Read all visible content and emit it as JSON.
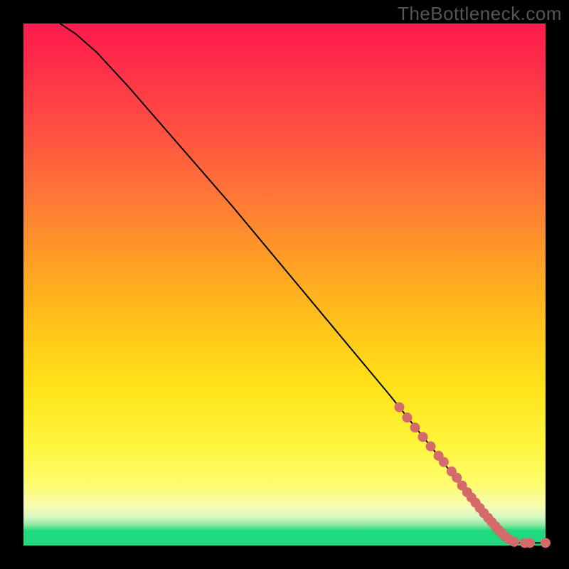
{
  "attribution": "TheBottleneck.com",
  "chart_data": {
    "type": "line",
    "title": "",
    "xlabel": "",
    "ylabel": "",
    "xlim": [
      0,
      100
    ],
    "ylim": [
      0,
      100
    ],
    "curve": {
      "x": [
        7,
        10,
        14,
        20,
        30,
        40,
        50,
        60,
        70,
        80,
        86,
        90,
        92,
        94,
        100
      ],
      "y": [
        100,
        98,
        94.5,
        88,
        76.5,
        65,
        53,
        41,
        29,
        16.5,
        8.5,
        3,
        1,
        0.5,
        0.5
      ]
    },
    "series": [
      {
        "name": "points",
        "x": [
          72,
          73.5,
          75,
          76.5,
          78,
          79.5,
          80.5,
          82,
          83,
          84,
          85,
          85.8,
          86.6,
          87.4,
          88.2,
          89,
          89.7,
          90.4,
          91,
          91.6,
          92.2,
          93,
          94,
          96,
          97,
          100
        ],
        "y": [
          26.5,
          24.5,
          22.6,
          20.8,
          19,
          17.2,
          16,
          14.2,
          13,
          11.5,
          10.2,
          9.2,
          8.2,
          7.2,
          6.2,
          5.3,
          4.5,
          3.7,
          3,
          2.4,
          1.8,
          1.2,
          0.7,
          0.5,
          0.5,
          0.5
        ]
      }
    ]
  },
  "colors": {
    "marker": "#d46a6a",
    "curve": "#000000"
  }
}
